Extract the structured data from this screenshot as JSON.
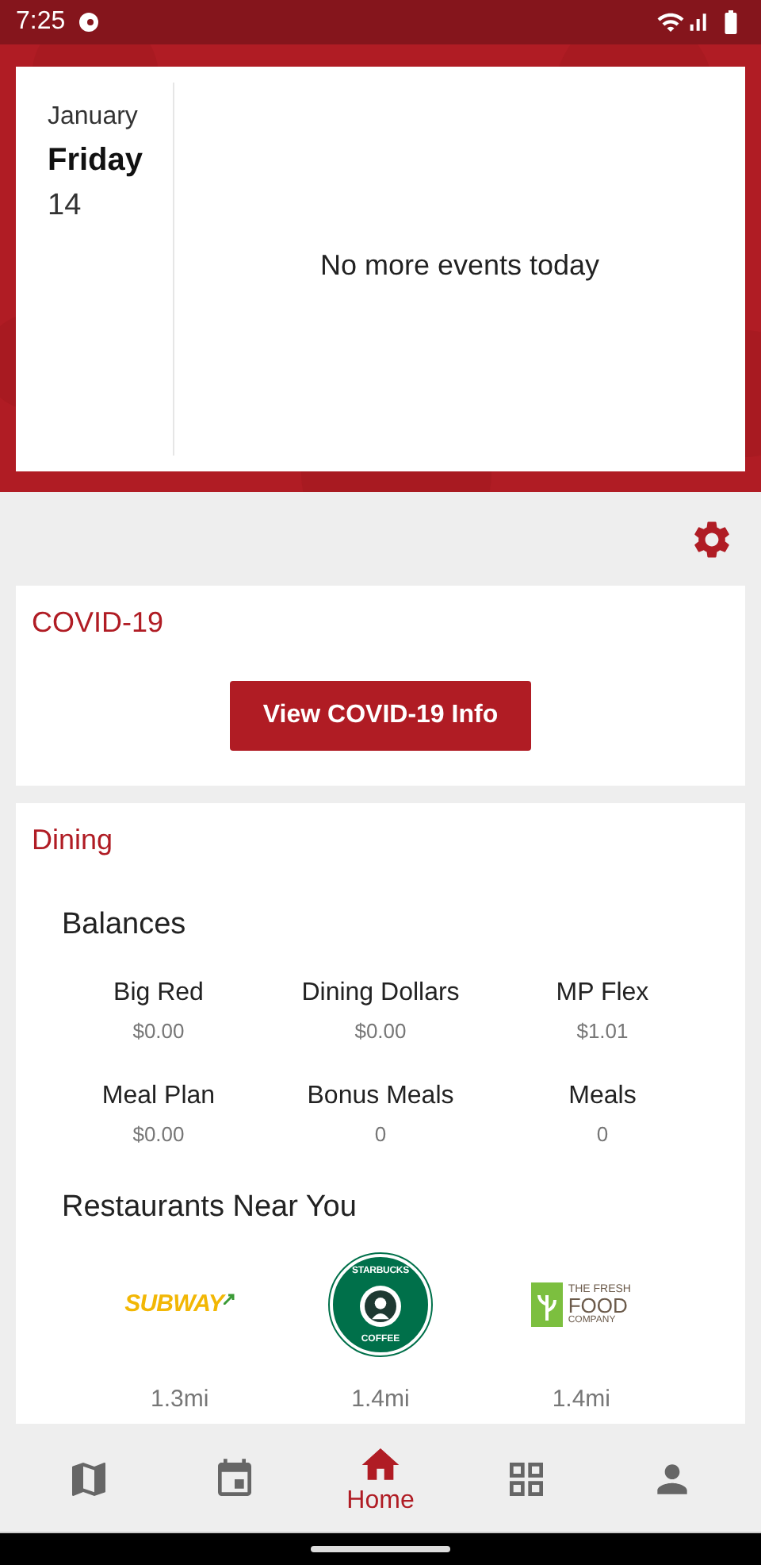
{
  "status_bar": {
    "time": "7:25"
  },
  "calendar": {
    "month": "January",
    "weekday": "Friday",
    "day": "14",
    "message": "No more events today"
  },
  "covid": {
    "title": "COVID-19",
    "button": "View COVID-19 Info"
  },
  "dining": {
    "title": "Dining",
    "balances_title": "Balances",
    "balances": [
      {
        "label": "Big Red",
        "value": "$0.00"
      },
      {
        "label": "Dining Dollars",
        "value": "$0.00"
      },
      {
        "label": "MP Flex",
        "value": "$1.01"
      },
      {
        "label": "Meal Plan",
        "value": "$0.00"
      },
      {
        "label": "Bonus Meals",
        "value": "0"
      },
      {
        "label": "Meals",
        "value": "0"
      }
    ],
    "restaurants_title": "Restaurants Near You",
    "restaurants": [
      {
        "kind": "subway",
        "logo_text": [
          "SUBWAY"
        ],
        "distance": "1.3mi"
      },
      {
        "kind": "starbucks",
        "logo_text": [
          "STARBUCKS",
          "COFFEE"
        ],
        "distance": "1.4mi"
      },
      {
        "kind": "freshfood",
        "logo_text": [
          "THE FRESH",
          "FOOD",
          "COMPANY"
        ],
        "distance": "1.4mi"
      }
    ]
  },
  "nav": [
    {
      "kind": "map",
      "selected": false
    },
    {
      "kind": "calendar",
      "selected": false
    },
    {
      "kind": "home",
      "label": "Home",
      "selected": true
    },
    {
      "kind": "grid",
      "selected": false
    },
    {
      "kind": "person",
      "selected": false
    }
  ]
}
